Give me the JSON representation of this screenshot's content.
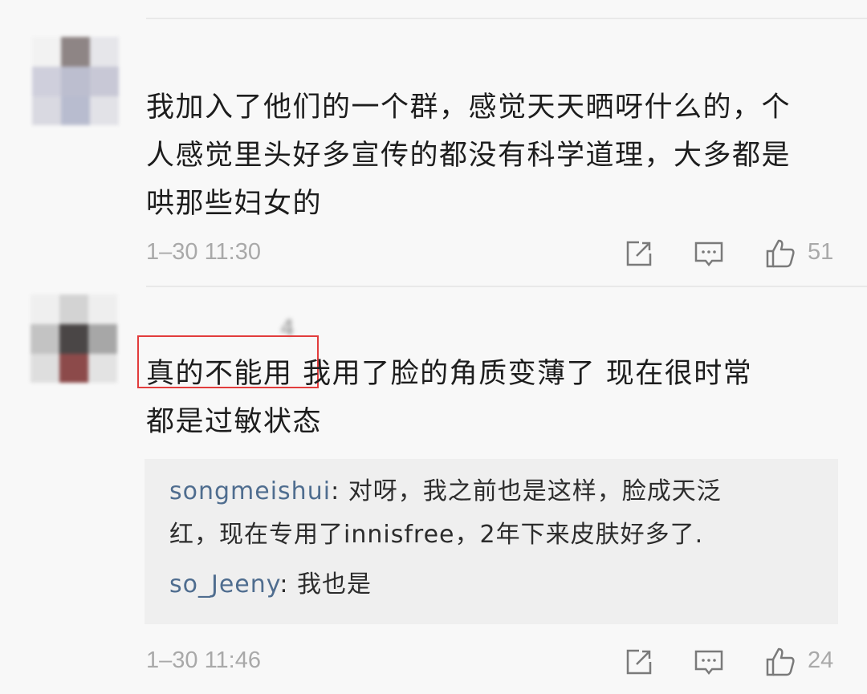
{
  "comments": [
    {
      "username": "",
      "lines": [
        "我加入了他们的一个群，感觉天天晒呀什么的，个",
        "人感觉里头好多宣传的都没有科学道理，大多都是",
        "哄那些妇女的"
      ],
      "timestamp": "1–30 11:30",
      "likes": "51",
      "icons": {
        "share": "share-icon",
        "reply": "reply-icon",
        "like": "thumbs-up-icon"
      }
    },
    {
      "username": "4",
      "lines": [
        "真的不能用  我用了脸的角质变薄了  现在很时常",
        "都是过敏状态"
      ],
      "timestamp": "1–30 11:46",
      "likes": "24",
      "replies": [
        {
          "name": "songmeishui",
          "sep": ": ",
          "lines": [
            "对呀，我之前也是这样，脸成天泛",
            "红，现在专用了innisfree，2年下来皮肤好多了."
          ]
        },
        {
          "name": "so_Jeeny",
          "sep": ": ",
          "lines": [
            "我也是"
          ]
        }
      ],
      "icons": {
        "share": "share-icon",
        "reply": "reply-icon",
        "like": "thumbs-up-icon"
      }
    }
  ],
  "colors": {
    "background": "#f8f8f8",
    "reply_background": "#efefef",
    "username_link": "#4f6d8f",
    "meta_gray": "#a9a9a9",
    "highlight_red": "#e23c3c"
  }
}
